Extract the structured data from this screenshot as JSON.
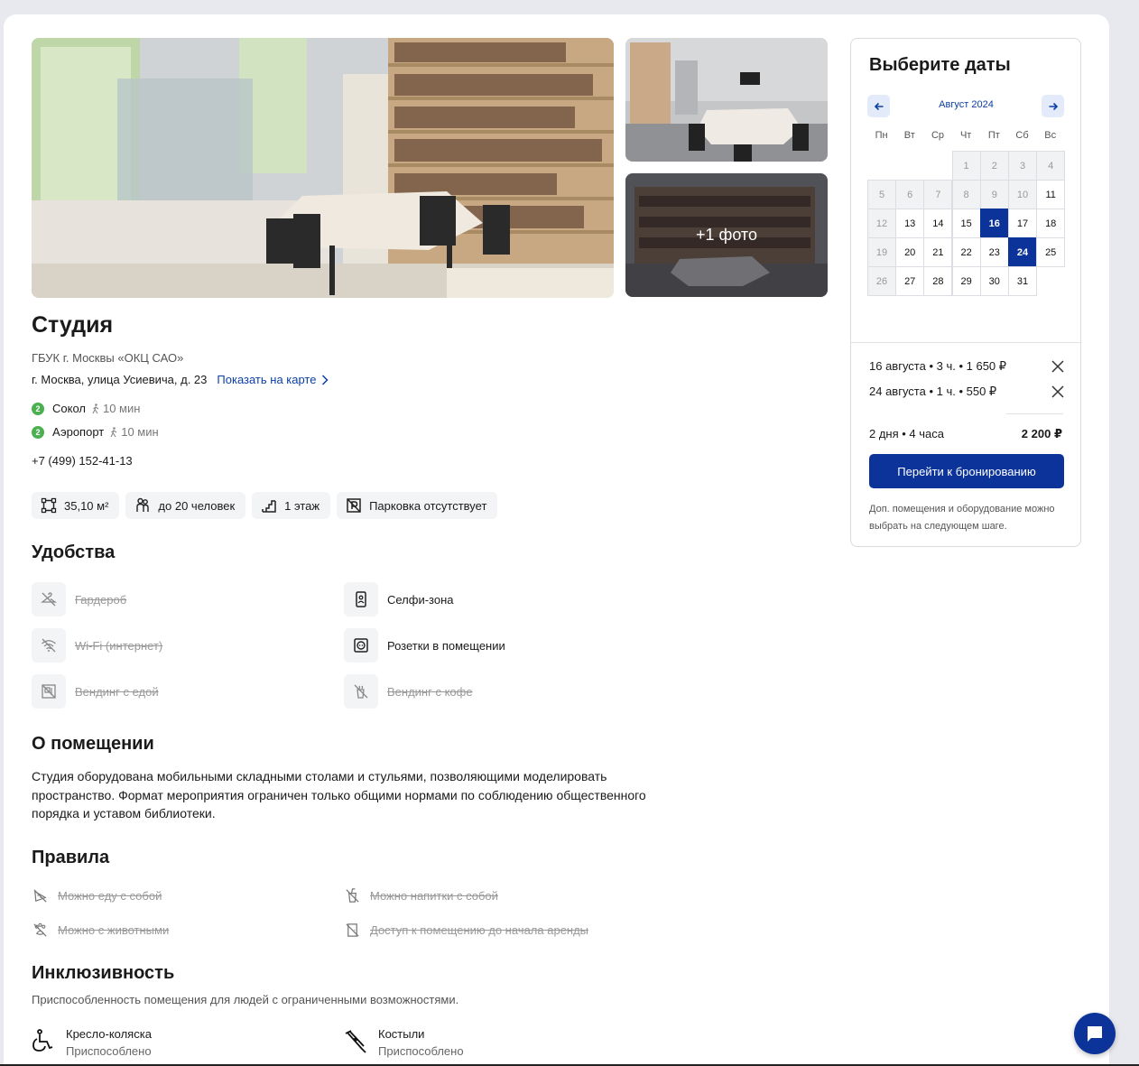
{
  "venue": {
    "title": "Студия",
    "org": "ГБУК г. Москвы «ОКЦ САО»",
    "address": "г. Москва, улица Усиевича, д. 23",
    "map_link": "Показать на карте",
    "metro": [
      {
        "line": "2",
        "name": "Сокол",
        "walk": "10 мин",
        "color": "#4caf50"
      },
      {
        "line": "2",
        "name": "Аэропорт",
        "walk": "10 мин",
        "color": "#4caf50"
      }
    ],
    "phone": "+7 (499) 152-41-13",
    "more_photos": "+1 фото",
    "features": [
      "35,10 м²",
      "до 20 человек",
      "1 этаж",
      "Парковка отсутствует"
    ]
  },
  "amenities": {
    "heading": "Удобства",
    "items": [
      {
        "label": "Гардероб",
        "available": false,
        "icon": "hanger-off-icon"
      },
      {
        "label": "Селфи-зона",
        "available": true,
        "icon": "selfie-icon"
      },
      {
        "label": "Wi-Fi (интернет)",
        "available": false,
        "icon": "wifi-off-icon"
      },
      {
        "label": "Розетки в помещении",
        "available": true,
        "icon": "socket-icon"
      },
      {
        "label": "Вендинг с едой",
        "available": false,
        "icon": "vending-food-off-icon"
      },
      {
        "label": "Вендинг с кофе",
        "available": false,
        "icon": "vending-coffee-off-icon"
      }
    ]
  },
  "about": {
    "heading": "О помещении",
    "text": "Студия оборудована мобильными складными столами и стульями, позволяющими моделировать пространство. Формат мероприятия ограничен только общими нормами по соблюдению общественного порядка и уставом библиотеки."
  },
  "rules": {
    "heading": "Правила",
    "items": [
      {
        "label": "Можно еду с собой",
        "allowed": false
      },
      {
        "label": "Можно напитки с собой",
        "allowed": false
      },
      {
        "label": "Можно с животными",
        "allowed": false
      },
      {
        "label": "Доступ к помещению до начала аренды",
        "allowed": false
      }
    ]
  },
  "inclusivity": {
    "heading": "Инклюзивность",
    "subtitle": "Приспособленность помещения для людей с ограниченными возможностями.",
    "items": [
      {
        "label": "Кресло-коляска",
        "status": "Приспособлено"
      },
      {
        "label": "Костыли",
        "status": "Приспособлено"
      }
    ]
  },
  "booking": {
    "title": "Выберите даты",
    "month": "Август 2024",
    "weekdays": [
      "Пн",
      "Вт",
      "Ср",
      "Чт",
      "Пт",
      "Сб",
      "Вс"
    ],
    "first_weekday_index": 3,
    "days_in_month": 31,
    "past_until": 10,
    "selected": [
      16,
      24
    ],
    "bookings": [
      {
        "text": "16 августа • 3 ч. • 1 650 ₽"
      },
      {
        "text": "24 августа • 1 ч. • 550 ₽"
      }
    ],
    "total_label": "2 дня • 4 часа",
    "total_value": "2 200 ₽",
    "button": "Перейти к бронированию",
    "note": "Доп. помещения и оборудование можно выбрать на следующем шаге.",
    "accent": "#0b3399"
  }
}
